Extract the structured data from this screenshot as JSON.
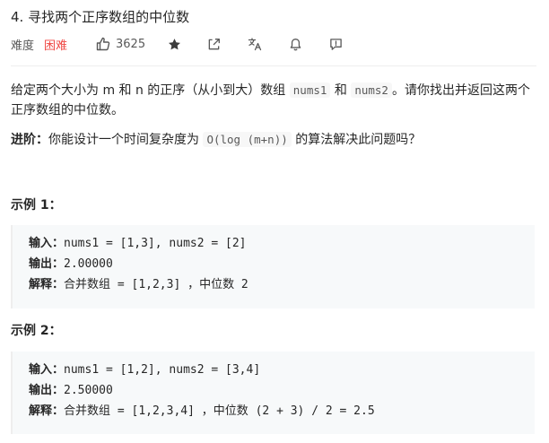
{
  "problem": {
    "title": "4. 寻找两个正序数组的中位数",
    "difficulty_label": "难度",
    "difficulty": "困难",
    "likes": "3625"
  },
  "toolbar": {
    "icons": [
      "thumbs-up-icon",
      "star-icon",
      "share-icon",
      "translate-icon",
      "bell-icon",
      "feedback-icon"
    ]
  },
  "description": {
    "p1_pre": "给定两个大小为 m 和 n 的正序（从小到大）数组 ",
    "p1_code1": "nums1",
    "p1_mid": " 和 ",
    "p1_code2": "nums2",
    "p1_post": "。请你找出并返回这两个正序数组的中位数。",
    "p2_label": "进阶：",
    "p2_pre": "你能设计一个时间复杂度为 ",
    "p2_code": "O(log (m+n))",
    "p2_post": " 的算法解决此问题吗？"
  },
  "examples": [
    {
      "title": "示例 1：",
      "input_label": "输入：",
      "input": "nums1 = [1,3], nums2 = [2]",
      "output_label": "输出：",
      "output": "2.00000",
      "explain_label": "解释：",
      "explain": "合并数组 = [1,2,3] ，中位数 2"
    },
    {
      "title": "示例 2：",
      "input_label": "输入：",
      "input": "nums1 = [1,2], nums2 = [3,4]",
      "output_label": "输出：",
      "output": "2.50000",
      "explain_label": "解释：",
      "explain": "合并数组 = [1,2,3,4] ，中位数 (2 + 3) / 2 = 2.5"
    }
  ],
  "colors": {
    "difficulty_hard": "#ef4743",
    "text": "#262626",
    "muted": "#595959",
    "code_bg": "#f7f7f7",
    "example_bg": "#f7f9fa"
  }
}
